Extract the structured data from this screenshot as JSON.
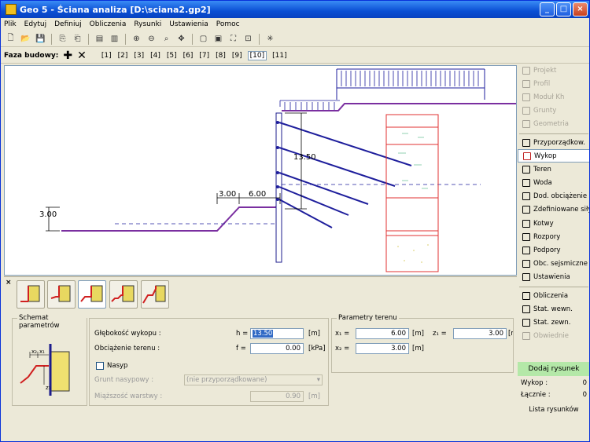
{
  "window": {
    "title": "Geo 5 - Ściana analiza [D:\\sciana2.gp2]",
    "min": "_",
    "max": "□",
    "close": "×"
  },
  "menu": [
    "Plik",
    "Edytuj",
    "Definiuj",
    "Obliczenia",
    "Rysunki",
    "Ustawienia",
    "Pomoc"
  ],
  "stages": {
    "label": "Faza budowy:",
    "items": [
      "[1]",
      "[2]",
      "[3]",
      "[4]",
      "[5]",
      "[6]",
      "[7]",
      "[8]",
      "[9]",
      "[10]",
      "[11]"
    ],
    "active_index": 9
  },
  "canvas": {
    "dim_depth": "13.50",
    "dim_x2": "3.00",
    "dim_x1": "6.00",
    "dim_z1": "3.00"
  },
  "sidebar": {
    "group1": [
      {
        "label": "Projekt",
        "enabled": false
      },
      {
        "label": "Profil",
        "enabled": false
      },
      {
        "label": "Moduł Kh",
        "enabled": false
      },
      {
        "label": "Grunty",
        "enabled": false
      },
      {
        "label": "Geometria",
        "enabled": false
      }
    ],
    "group2": [
      {
        "label": "Przyporządkow.",
        "enabled": true
      },
      {
        "label": "Wykop",
        "enabled": true,
        "selected": true
      },
      {
        "label": "Teren",
        "enabled": true
      },
      {
        "label": "Woda",
        "enabled": true
      },
      {
        "label": "Dod. obciążenie",
        "enabled": true
      },
      {
        "label": "Zdefiniowane siły",
        "enabled": true
      },
      {
        "label": "Kotwy",
        "enabled": true
      },
      {
        "label": "Rozpory",
        "enabled": true
      },
      {
        "label": "Podpory",
        "enabled": true
      },
      {
        "label": "Obc. sejsmiczne",
        "enabled": true
      },
      {
        "label": "Ustawienia",
        "enabled": true
      }
    ],
    "group3": [
      {
        "label": "Obliczenia",
        "enabled": true
      },
      {
        "label": "Stat. wewn.",
        "enabled": true
      },
      {
        "label": "Stat. zewn.",
        "enabled": true
      },
      {
        "label": "Obwiednie",
        "enabled": false
      }
    ],
    "add_drawing": "Dodaj rysunek",
    "counts": [
      {
        "label": "Wykop :",
        "value": "0"
      },
      {
        "label": "Łącznie :",
        "value": "0"
      }
    ],
    "list_button": "Lista rysunków"
  },
  "panel": {
    "close": "×",
    "schema_title": "Schemat parametrów",
    "schema_labels": {
      "x2": "x₂",
      "x1": "x₁",
      "z1": "z₁"
    },
    "depth": {
      "label": "Głębokość wykopu :",
      "var": "h =",
      "value": "13.50",
      "unit": "[m]"
    },
    "load": {
      "label": "Obciążenie terenu :",
      "var": "f =",
      "value": "0.00",
      "unit": "[kPa]"
    },
    "embankment": {
      "label": "Nasyp",
      "checked": false
    },
    "soil": {
      "label": "Grunt nasypowy :",
      "value": "(nie przyporządkowane)"
    },
    "thickness": {
      "label": "Miąższość warstwy :",
      "value": "0.90",
      "unit": "[m]"
    },
    "terrain": {
      "title": "Parametry terenu",
      "x1": {
        "var": "x₁ =",
        "value": "6.00",
        "unit": "[m]"
      },
      "z1": {
        "var": "z₁ =",
        "value": "3.00",
        "unit": "[m]"
      },
      "x2": {
        "var": "x₂ =",
        "value": "3.00",
        "unit": "[m]"
      }
    }
  },
  "colors": {
    "wall": "#1c1c8c",
    "terrain": "#7a2fa0",
    "anchor": "#1e1e9c",
    "borehole": "#e03030",
    "dim": "#000000"
  }
}
